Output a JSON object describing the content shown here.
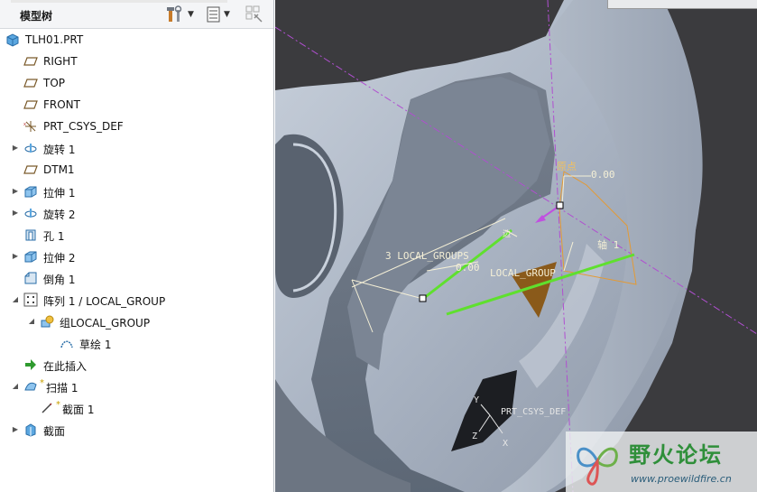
{
  "model_tree": {
    "title": "模型树",
    "items": [
      {
        "label": "TLH01.PRT",
        "icon": "part-icon",
        "indent": 0,
        "expand": ""
      },
      {
        "label": "RIGHT",
        "icon": "datum-plane-icon",
        "indent": 1,
        "expand": ""
      },
      {
        "label": "TOP",
        "icon": "datum-plane-icon",
        "indent": 1,
        "expand": ""
      },
      {
        "label": "FRONT",
        "icon": "datum-plane-icon",
        "indent": 1,
        "expand": ""
      },
      {
        "label": "PRT_CSYS_DEF",
        "icon": "coordinate-system-icon",
        "indent": 1,
        "expand": ""
      },
      {
        "label": "旋转 1",
        "icon": "revolve-icon",
        "indent": 1,
        "expand": "collapsed"
      },
      {
        "label": "DTM1",
        "icon": "datum-plane-icon",
        "indent": 1,
        "expand": ""
      },
      {
        "label": "拉伸 1",
        "icon": "extrude-icon",
        "indent": 1,
        "expand": "collapsed"
      },
      {
        "label": "旋转 2",
        "icon": "revolve-icon",
        "indent": 1,
        "expand": "collapsed"
      },
      {
        "label": "孔 1",
        "icon": "hole-icon",
        "indent": 1,
        "expand": ""
      },
      {
        "label": "拉伸 2",
        "icon": "extrude-icon",
        "indent": 1,
        "expand": "collapsed"
      },
      {
        "label": "倒角 1",
        "icon": "chamfer-icon",
        "indent": 1,
        "expand": ""
      },
      {
        "label": "阵列 1 / LOCAL_GROUP",
        "icon": "pattern-icon",
        "indent": 1,
        "expand": "expanded"
      },
      {
        "label": "组LOCAL_GROUP",
        "icon": "group-icon",
        "indent": 2,
        "expand": "expanded"
      },
      {
        "label": "草绘 1",
        "icon": "sketch-icon",
        "indent": 3,
        "expand": ""
      },
      {
        "label": "在此插入",
        "icon": "insert-here-icon",
        "indent": 1,
        "expand": ""
      },
      {
        "label": "扫描 1",
        "icon": "sweep-icon",
        "indent": 1,
        "expand": "expanded",
        "flag": "*"
      },
      {
        "label": "截面 1",
        "icon": "section-sketch-icon",
        "indent": 2,
        "expand": "",
        "flag": "*"
      },
      {
        "label": "截面",
        "icon": "section-icon",
        "indent": 1,
        "expand": "collapsed"
      }
    ]
  },
  "viewport": {
    "annotations": {
      "dim_top": "0.00",
      "group_label_3": "3 LOCAL_GROUPS",
      "dim_left": "0.00",
      "local_group_label": "LOCAL_GROUP",
      "axis_label": "轴 1",
      "ref_label": "边",
      "orange_label": "原点",
      "csys_label": "PRT_CSYS_DEF",
      "csys_y": "Y",
      "csys_z": "Z",
      "csys_x": "X"
    }
  },
  "watermark": {
    "name": "野火论坛",
    "url": "www.proewildfire.cn"
  },
  "colors": {
    "viewport_bg": "#3b3b3e",
    "model_gray": "#a9b3c2",
    "sketch_green": "#5fe02e",
    "datum_purple": "#b04fd0",
    "annotation_yellow": "#f4efd6",
    "orange_plane": "#e39a35"
  }
}
